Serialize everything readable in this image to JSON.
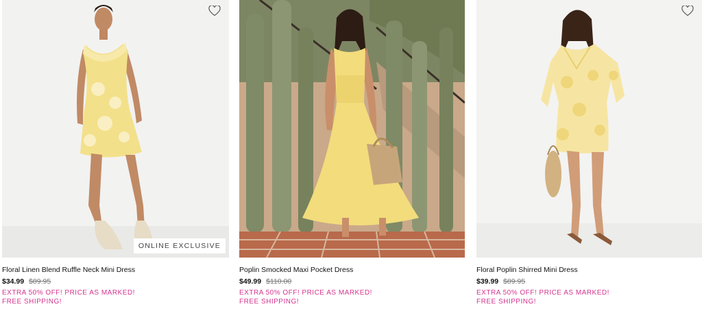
{
  "products": [
    {
      "name": "Floral Linen Blend Ruffle Neck Mini Dress",
      "price_sale": "$34.99",
      "price_original": "$89.95",
      "promo": "EXTRA 50% OFF! PRICE AS MARKED!",
      "shipping": "FREE SHIPPING!",
      "badge": "ONLINE EXCLUSIVE",
      "image": "woman in yellow floral ruffle neck mini dress"
    },
    {
      "name": "Poplin Smocked Maxi Pocket Dress",
      "price_sale": "$49.99",
      "price_original": "$110.00",
      "promo": "EXTRA 50% OFF! PRICE AS MARKED!",
      "shipping": "FREE SHIPPING!",
      "image": "woman in yellow maxi dress with straw bag by cacti"
    },
    {
      "name": "Floral Poplin Shirred Mini Dress",
      "price_sale": "$39.99",
      "price_original": "$89.95",
      "promo": "EXTRA 50% OFF! PRICE AS MARKED!",
      "shipping": "FREE SHIPPING!",
      "image": "woman in yellow floral puff sleeve mini dress"
    }
  ],
  "colors": {
    "promo": "#d4338f",
    "dress_yellow": "#f2dc7c"
  },
  "icons": {
    "favorite": "heart-outline-icon"
  }
}
